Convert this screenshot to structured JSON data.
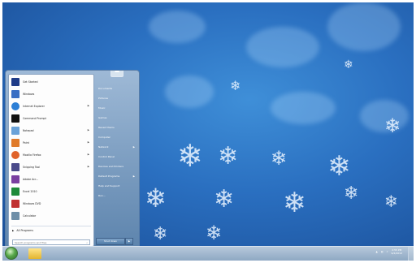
{
  "desktop": {
    "wallpaper": "blue-snowflakes"
  },
  "start_menu": {
    "programs": [
      {
        "label": "Get Started",
        "icon": "get-started-icon",
        "color": "#1f3c88",
        "has_submenu": false
      },
      {
        "label": "Windows",
        "icon": "windows-media-icon",
        "color": "#3a6fc4",
        "has_submenu": false
      },
      {
        "label": "Internet Explorer",
        "icon": "internet-explorer-icon",
        "color": "#2d7fd6",
        "has_submenu": true
      },
      {
        "label": "Command Prompt",
        "icon": "command-prompt-icon",
        "color": "#111111",
        "has_submenu": false
      },
      {
        "label": "Notepad",
        "icon": "notepad-icon",
        "color": "#6aa2d8",
        "has_submenu": true
      },
      {
        "label": "Paint",
        "icon": "paint-icon",
        "color": "#e07b2b",
        "has_submenu": true
      },
      {
        "label": "Mozilla Firefox",
        "icon": "firefox-icon",
        "color": "#e0632a",
        "has_submenu": true
      },
      {
        "label": "Snipping Tool",
        "icon": "snipping-tool-icon",
        "color": "#4a4a8a",
        "has_submenu": true
      },
      {
        "label": "Adobe Acr...",
        "icon": "adobe-icon",
        "color": "#7a3fa0",
        "has_submenu": false
      },
      {
        "label": "Excel 2010",
        "icon": "excel-icon",
        "color": "#1f8a3a",
        "has_submenu": false
      },
      {
        "label": "Windows DVD",
        "icon": "dvd-maker-icon",
        "color": "#c03030",
        "has_submenu": false
      },
      {
        "label": "Calculator",
        "icon": "calculator-icon",
        "color": "#6f8fa8",
        "has_submenu": false
      }
    ],
    "all_programs": "All Programs",
    "search_placeholder": "Search programs and files",
    "right_items": [
      {
        "label": "Documents",
        "has_submenu": false
      },
      {
        "label": "Pictures",
        "has_submenu": false
      },
      {
        "label": "Music",
        "has_submenu": false
      },
      {
        "label": "Games",
        "has_submenu": false
      },
      {
        "label": "Recent Items",
        "has_submenu": false
      },
      {
        "label": "Computer",
        "has_submenu": false
      },
      {
        "label": "Network",
        "has_submenu": true
      },
      {
        "label": "Control Panel",
        "has_submenu": false
      },
      {
        "label": "Devices and Printers",
        "has_submenu": false
      },
      {
        "label": "Default Programs",
        "has_submenu": true
      },
      {
        "label": "Help and Support",
        "has_submenu": false
      },
      {
        "label": "Run...",
        "has_submenu": false
      }
    ],
    "shutdown_label": "Shut down"
  },
  "taskbar": {
    "clock_time": "2:55 PM",
    "clock_date": "9/4/2012"
  }
}
